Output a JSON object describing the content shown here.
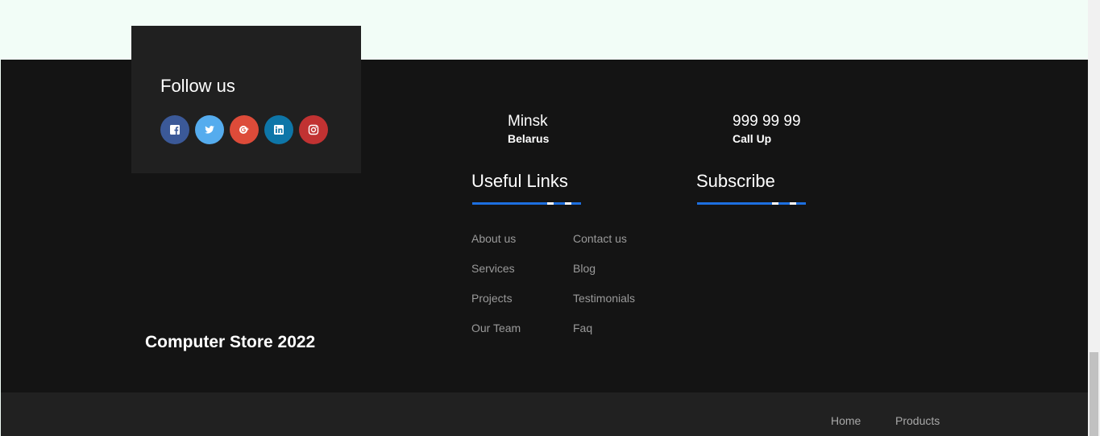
{
  "footer": {
    "follow": {
      "title": "Follow us",
      "social": [
        {
          "name": "facebook-icon",
          "color": "#3b5998"
        },
        {
          "name": "twitter-icon",
          "color": "#55acee"
        },
        {
          "name": "google-plus-icon",
          "color": "#dd4b39"
        },
        {
          "name": "linkedin-icon",
          "color": "#0e76a8"
        },
        {
          "name": "instagram-icon",
          "color": "#c13232"
        }
      ]
    },
    "copyright": "Computer Store 2022",
    "location": {
      "city": "Minsk",
      "country": "Belarus"
    },
    "phone": {
      "number": "999 99 99",
      "label": "Call Up"
    },
    "useful_links": {
      "title": "Useful Links",
      "col1": [
        "About us",
        "Services",
        "Projects",
        "Our Team"
      ],
      "col2": [
        "Contact us",
        "Blog",
        "Testimonials",
        "Faq"
      ]
    },
    "subscribe": {
      "title": "Subscribe"
    },
    "accent_color": "#1d6fe0"
  },
  "bottom_nav": {
    "items": [
      "Home",
      "Products"
    ]
  }
}
